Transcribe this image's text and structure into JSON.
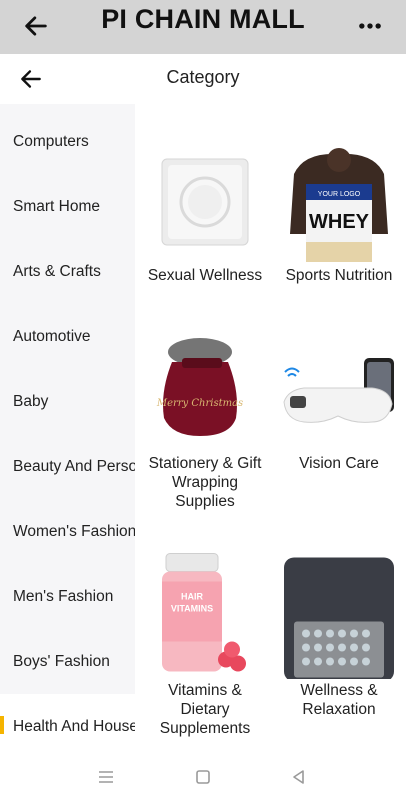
{
  "app_bar": {
    "title": "PI CHAIN MALL",
    "back_icon": "arrow-left-icon",
    "more_icon": "more-dots-icon"
  },
  "sub_bar": {
    "title": "Category",
    "back_icon": "arrow-left-icon"
  },
  "sidebar": {
    "active_accent": "#f5b400",
    "items": [
      {
        "label": "Computers"
      },
      {
        "label": "Smart Home"
      },
      {
        "label": "Arts & Crafts"
      },
      {
        "label": "Automotive"
      },
      {
        "label": "Baby"
      },
      {
        "label": "Beauty And Personal Care"
      },
      {
        "label": "Women's Fashion"
      },
      {
        "label": "Men's Fashion"
      },
      {
        "label": "Boys' Fashion"
      },
      {
        "label": "Health And Household"
      }
    ]
  },
  "categories": [
    {
      "label": "Sexual Wellness"
    },
    {
      "label": "Sports Nutrition"
    },
    {
      "label": "Stationery & Gift Wrapping Supplies"
    },
    {
      "label": "Vision Care"
    },
    {
      "label": "Vitamins & Dietary Supplements"
    },
    {
      "label": "Wellness & Relaxation"
    }
  ],
  "images": {
    "whey_brand": "YOUR LOGO",
    "whey_text": "WHEY",
    "gift_text": "Merry Christmas",
    "vitamin_brand": "HAIR",
    "vitamin_text": "VITAMINS"
  },
  "system_nav": {
    "menu_icon": "menu-lines-icon",
    "home_icon": "home-square-icon",
    "back_icon": "back-triangle-icon"
  }
}
